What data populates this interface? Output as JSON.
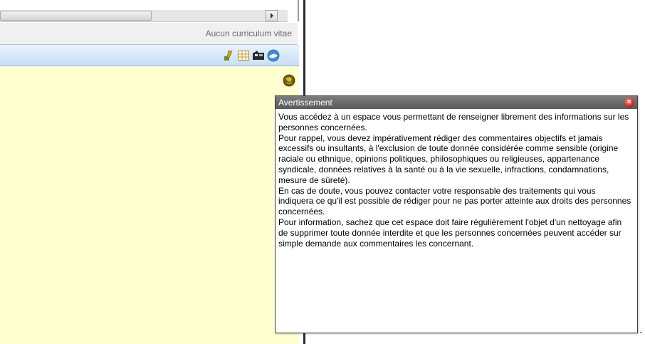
{
  "status": {
    "cv_text": "Aucun curriculum vitae"
  },
  "toolbar": {
    "icons": [
      "edit-pen-icon",
      "table-grid-icon",
      "camera-film-icon",
      "help-globe-icon"
    ]
  },
  "notes": {
    "icon": "world-globe-icon"
  },
  "popup": {
    "title": "Avertissement",
    "close_icon": "close-icon",
    "paragraphs": [
      "Vous accédez à un espace vous permettant de renseigner librement des informations sur les personnes concernées.",
      "Pour rappel, vous devez impérativement rédiger des commentaires objectifs et jamais excessifs ou insultants, à l'exclusion de toute donnée considérée comme sensible (origine raciale ou ethnique, opinions politiques, philosophiques ou religieuses, appartenance syndicale, données relatives à la santé ou à la vie sexuelle, infractions, condamnations, mesure de sûreté).",
      "En cas de doute, vous pouvez contacter votre responsable des traitements qui vous indiquera ce qu'il est possible de rédiger pour ne pas porter atteinte aux droits des personnes concernées.",
      "Pour information, sachez que cet espace doit faire régulièrement l'objet d'un nettoyage afin de supprimer toute donnée interdite et que les personnes concernées peuvent accéder sur simple demande aux commentaires les concernant."
    ]
  },
  "colors": {
    "toolbar_blue": "#c9def5",
    "notes_yellow": "#ffffcf",
    "popup_title_gray": "#5a5a5a",
    "close_red": "#c92a1e"
  }
}
